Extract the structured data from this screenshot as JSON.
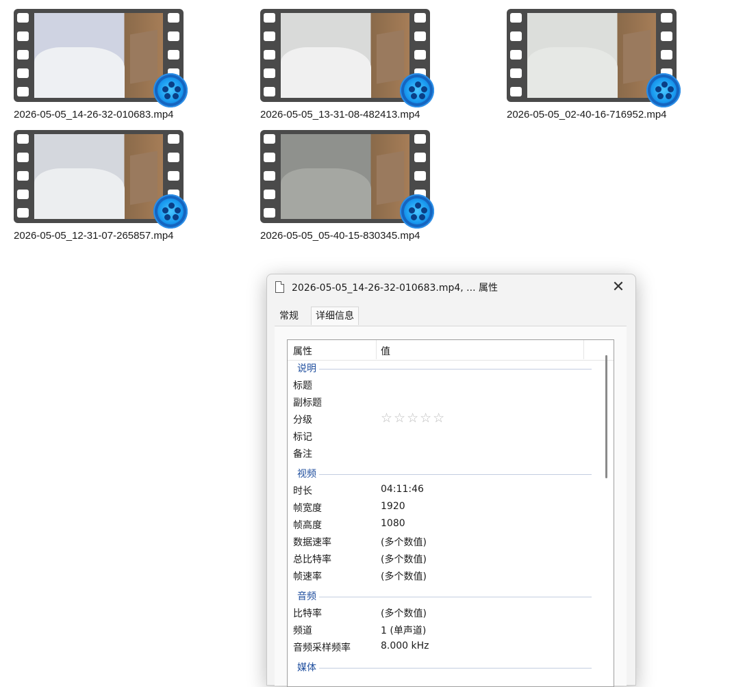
{
  "files": [
    {
      "name": "2026-05-05_14-26-32-010683.mp4"
    },
    {
      "name": "2026-05-05_13-31-08-482413.mp4"
    },
    {
      "name": "2026-05-05_02-40-16-716952.mp4"
    },
    {
      "name": "2026-05-05_12-31-07-265857.mp4"
    },
    {
      "name": "2026-05-05_05-40-15-830345.mp4"
    }
  ],
  "dialog": {
    "title": "2026-05-05_14-26-32-010683.mp4, ... 属性",
    "close_glyph": "✕",
    "tabs": [
      "常规",
      "详细信息"
    ],
    "active_tab": "详细信息",
    "header": {
      "property": "属性",
      "value": "值"
    },
    "groups": {
      "description": {
        "label": "说明",
        "rows": [
          {
            "k": "标题",
            "v": ""
          },
          {
            "k": "副标题",
            "v": ""
          },
          {
            "k": "分级",
            "v": "☆☆☆☆☆"
          },
          {
            "k": "标记",
            "v": ""
          },
          {
            "k": "备注",
            "v": ""
          }
        ]
      },
      "video": {
        "label": "视频",
        "rows": [
          {
            "k": "时长",
            "v": "04:11:46"
          },
          {
            "k": "帧宽度",
            "v": "1920"
          },
          {
            "k": "帧高度",
            "v": "1080"
          },
          {
            "k": "数据速率",
            "v": "(多个数值)"
          },
          {
            "k": "总比特率",
            "v": "(多个数值)"
          },
          {
            "k": "帧速率",
            "v": "(多个数值)"
          }
        ]
      },
      "audio": {
        "label": "音频",
        "rows": [
          {
            "k": "比特率",
            "v": "(多个数值)"
          },
          {
            "k": "频道",
            "v": "1 (单声道)"
          },
          {
            "k": "音频采样频率",
            "v": "8.000 kHz"
          }
        ]
      },
      "media": {
        "label": "媒体"
      }
    }
  },
  "colors": {
    "accent": "#1f4e9e",
    "player_icon": "#1a9bf0"
  },
  "icons": {
    "player": "qq-player-icon",
    "document": "document-icon",
    "close": "close-icon"
  }
}
